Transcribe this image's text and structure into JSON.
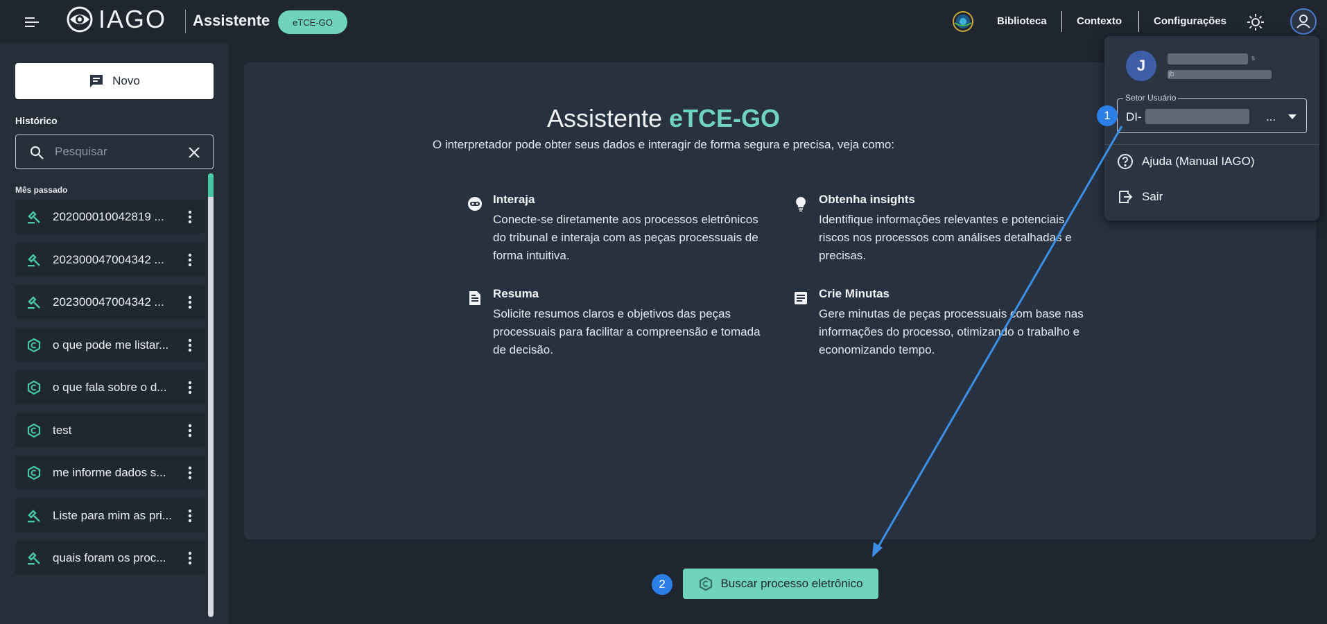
{
  "header": {
    "logo_text": "IAGO",
    "app_title": "Assistente",
    "badge": "eTCE-GO",
    "nav": [
      "Biblioteca",
      "Contexto",
      "Configurações"
    ]
  },
  "sidebar": {
    "new_label": "Novo",
    "history_label": "Histórico",
    "search_placeholder": "Pesquisar",
    "group_label": "Mês passado",
    "items": [
      {
        "text": "202000010042819 ...",
        "icon": "gavel-icon"
      },
      {
        "text": "202300047004342 ...",
        "icon": "gavel-icon"
      },
      {
        "text": "202300047004342 ...",
        "icon": "gavel-icon"
      },
      {
        "text": "o que pode me listar...",
        "icon": "etce-icon"
      },
      {
        "text": "o que fala sobre o d...",
        "icon": "etce-icon"
      },
      {
        "text": "test",
        "icon": "etce-icon"
      },
      {
        "text": "me informe dados s...",
        "icon": "etce-icon"
      },
      {
        "text": "Liste para mim as pri...",
        "icon": "gavel-icon"
      },
      {
        "text": "quais foram os proc...",
        "icon": "gavel-icon"
      }
    ]
  },
  "main": {
    "title_prefix": "Assistente",
    "title_accent": "eTCE-GO",
    "subtitle": "O interpretador pode obter seus dados e interagir de forma segura e precisa, veja como:",
    "features": [
      {
        "icon": "robot-face-icon",
        "title": "Interaja",
        "desc": "Conecte-se diretamente aos processos eletrônicos do tribunal e interaja com as peças processuais de forma intuitiva."
      },
      {
        "icon": "lightbulb-icon",
        "title": "Obtenha insights",
        "desc": "Identifique informações relevantes e potenciais riscos nos processos com análises detalhadas e precisas."
      },
      {
        "icon": "document-icon",
        "title": "Resuma",
        "desc": "Solicite resumos claros e objetivos das peças processuais para facilitar a compreensão e tomada de decisão."
      },
      {
        "icon": "article-icon",
        "title": "Crie Minutas",
        "desc": "Gere minutas de peças processuais com base nas informações do processo, otimizando o trabalho e economizando tempo."
      }
    ],
    "search_button": "Buscar processo eletrônico"
  },
  "user_menu": {
    "avatar_letter": "J",
    "email_fragment": "jb",
    "name_fragment": "s",
    "sector_label": "Setor Usuário",
    "sector_value_prefix": "DI-",
    "sector_value_suffix": "...",
    "help": "Ajuda (Manual IAGO)",
    "logout": "Sair"
  },
  "annotations": {
    "step1": "1",
    "step2": "2",
    "arrow_color": "#3d8fe6"
  },
  "colors": {
    "accent": "#6fd3bd",
    "background": "#1f2630",
    "sidebar": "#262e39",
    "card": "#283140"
  }
}
